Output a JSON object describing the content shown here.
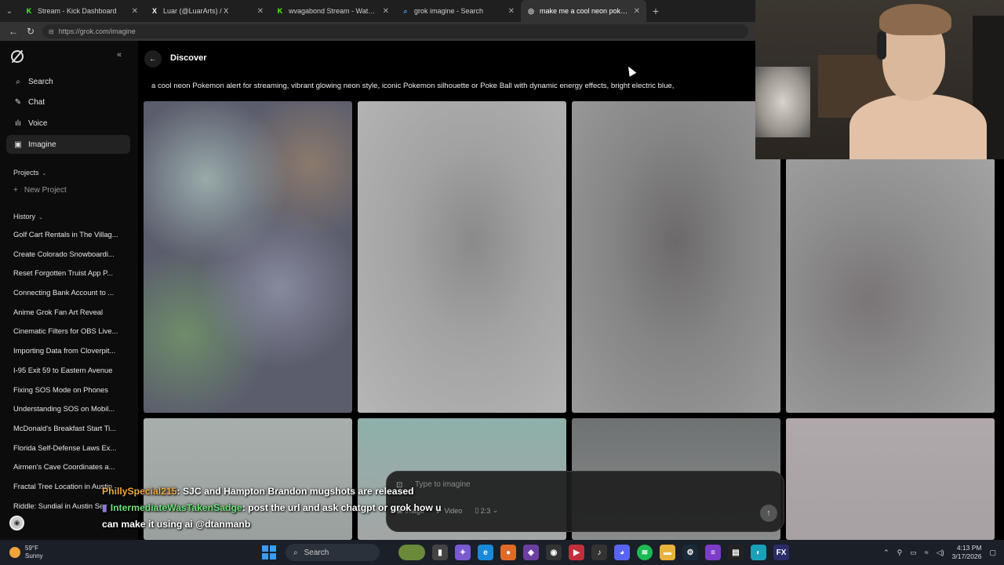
{
  "browser": {
    "tabs": [
      {
        "title": "Stream - Kick Dashboard",
        "favicon": "K",
        "color": "#53fc18",
        "active": false
      },
      {
        "title": "Luar (@LuarArts) / X",
        "favicon": "X",
        "color": "#ffffff",
        "active": false
      },
      {
        "title": "wvagabond Stream - Watch Live o",
        "favicon": "K",
        "color": "#53fc18",
        "active": false
      },
      {
        "title": "grok imagine - Search",
        "favicon": "⌕",
        "color": "#4a9cf0",
        "active": false
      },
      {
        "title": "make me a cool neon pokemon al",
        "favicon": "◎",
        "color": "#dddddd",
        "active": true
      }
    ],
    "new_tab": "+",
    "url": "https://grok.com/imagine"
  },
  "sidebar": {
    "nav": [
      {
        "label": "Search",
        "icon": "⌕"
      },
      {
        "label": "Chat",
        "icon": "✎"
      },
      {
        "label": "Voice",
        "icon": "ılı"
      },
      {
        "label": "Imagine",
        "icon": "▣"
      }
    ],
    "projects_label": "Projects",
    "new_project_label": "New Project",
    "history_label": "History",
    "history": [
      "Golf Cart Rentals in The Villag...",
      "Create Colorado Snowboardi...",
      "Reset Forgotten Truist App P...",
      "Connecting Bank Account to ...",
      "Anime Grok Fan Art Reveal",
      "Cinematic Filters for OBS Live...",
      "Importing Data from Cloverpit...",
      "I-95 Exit 59 to Eastern Avenue",
      "Fixing SOS Mode on Phones",
      "Understanding SOS on Mobil...",
      "McDonald's Breakfast Start Ti...",
      "Florida Self-Defense Laws Ex...",
      "Airmen's Cave Coordinates a...",
      "Fractal Tree Location in Austin",
      "Riddle: Sundial in Austin Sev"
    ]
  },
  "main": {
    "title": "Discover",
    "prompt": "a cool neon Pokemon alert for streaming, vibrant glowing neon style, iconic Pokemon silhouette or Poke Ball with dynamic energy effects, bright electric blue,"
  },
  "composer": {
    "placeholder": "Type to imagine",
    "mode_image": "Image",
    "mode_video": "Video",
    "aspect": "2:3"
  },
  "chat": {
    "msg1_user": "PhillySpecial215",
    "msg1_text": ": SJC and Hampton Brandon mugshots are released",
    "msg2_user": "IntermediateWasTakenSadge",
    "msg2_text": ": post the url and ask chatgpt or grok how u can make it using ai @dtanmanb"
  },
  "taskbar": {
    "temp": "59°F",
    "condition": "Sunny",
    "search_label": "Search",
    "time": "4:13 PM",
    "date": "3/17/2026"
  }
}
